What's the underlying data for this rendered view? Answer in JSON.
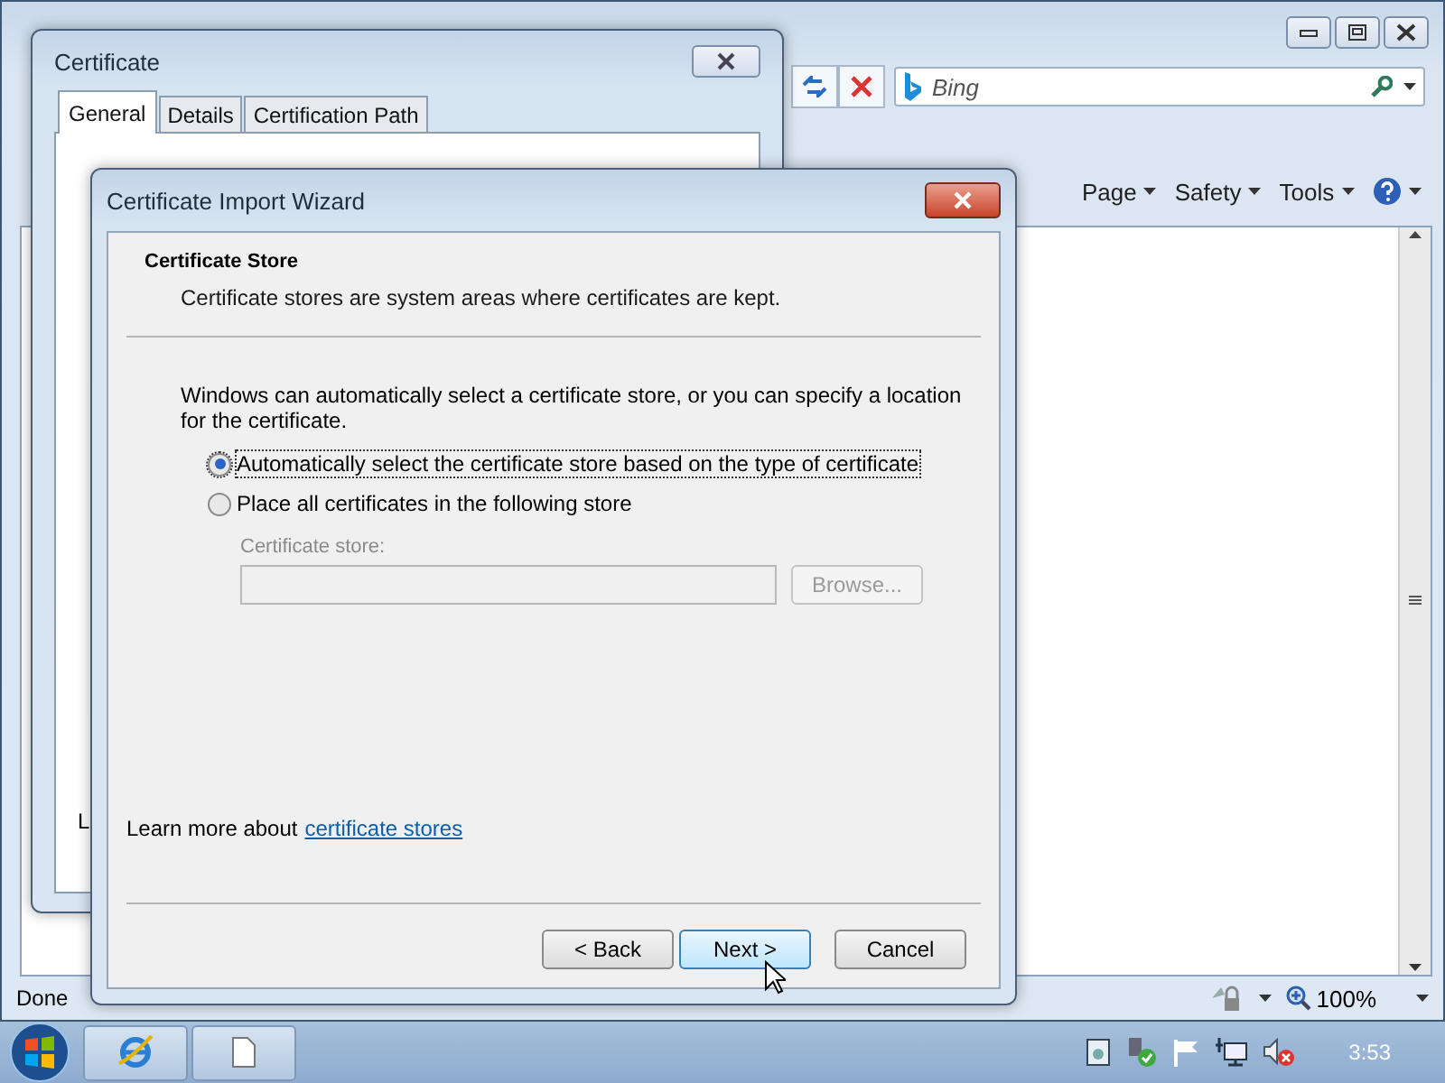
{
  "browser": {
    "search_placeholder": "Bing",
    "command_menus": [
      {
        "label": "Page"
      },
      {
        "label": "Safety"
      },
      {
        "label": "Tools"
      }
    ],
    "status_text": "Done",
    "zoom": "100%"
  },
  "certificate_dialog": {
    "title": "Certificate",
    "tabs": [
      {
        "label": "General",
        "selected": true
      },
      {
        "label": "Details",
        "selected": false
      },
      {
        "label": "Certification Path",
        "selected": false
      }
    ],
    "partial_text": "L"
  },
  "wizard": {
    "title": "Certificate Import Wizard",
    "heading": "Certificate Store",
    "subheading": "Certificate stores are system areas where certificates are kept.",
    "intro": "Windows can automatically select a certificate store, or you can specify a location for the certificate.",
    "options": [
      {
        "label": "Automatically select the certificate store based on the type of certificate",
        "selected": true
      },
      {
        "label": "Place all certificates in the following store",
        "selected": false
      }
    ],
    "store_label": "Certificate store:",
    "store_disabled": true,
    "browse": "Browse...",
    "learn_more": "Learn more about",
    "learn_link": "certificate stores",
    "buttons": [
      {
        "label": "< Back",
        "highlighted": false
      },
      {
        "label": "Next >",
        "highlighted": true
      },
      {
        "label": "Cancel",
        "highlighted": false
      }
    ]
  },
  "taskbar": {
    "clock": "3:53"
  }
}
